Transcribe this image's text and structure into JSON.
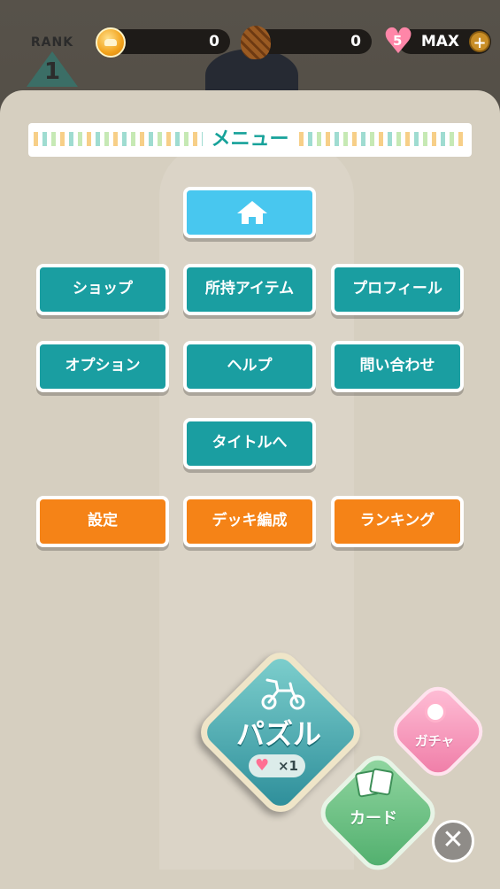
{
  "status_bar": {
    "rank_label": "RANK",
    "rank_value": "1",
    "coins": "0",
    "pinecones": "0",
    "hearts_count": "5",
    "hearts_status": "MAX",
    "add_label": "+"
  },
  "menu": {
    "title": "メニュー",
    "home_icon": "home-icon",
    "row1": [
      "ショップ",
      "所持アイテム",
      "プロフィール"
    ],
    "row2": [
      "オプション",
      "ヘルプ",
      "問い合わせ"
    ],
    "row3": [
      "タイトルへ"
    ],
    "row4": [
      "設定",
      "デッキ編成",
      "ランキング"
    ],
    "colors": {
      "teal": "#1a9ea1",
      "orange": "#f58317",
      "home": "#48c7ef"
    }
  },
  "actions": {
    "puzzle_label": "パズル",
    "puzzle_cost": "×1",
    "card_label": "カード",
    "gacha_label": "ガチャ",
    "close_label": "✕"
  }
}
